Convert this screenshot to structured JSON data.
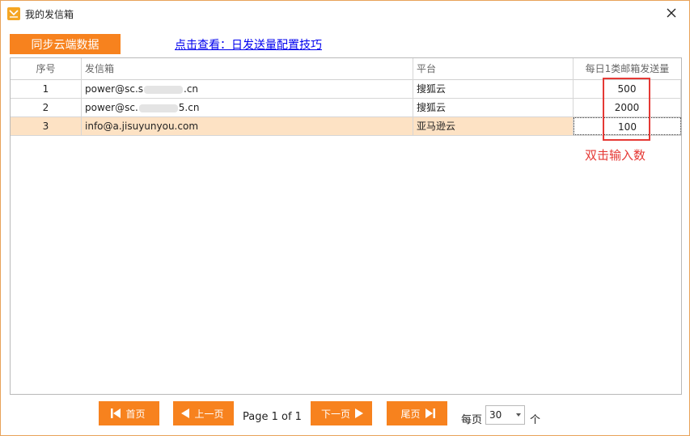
{
  "window": {
    "title": "我的发信箱",
    "close_label": "×"
  },
  "toolbar": {
    "sync_label": "同步云端数据",
    "help_link": "点击查看：日发送量配置技巧"
  },
  "grid": {
    "columns": [
      "序号",
      "发信箱",
      "平台",
      "每日1类邮箱发送量"
    ],
    "rows": [
      {
        "index": "1",
        "mailbox_prefix": "power@sc.s",
        "mailbox_suffix": ".cn",
        "platform": "搜狐云",
        "quantity": "500"
      },
      {
        "index": "2",
        "mailbox_prefix": "power@sc.",
        "mailbox_suffix": "5.cn",
        "platform": "搜狐云",
        "quantity": "2000"
      },
      {
        "index": "3",
        "mailbox_prefix": "info@a.jisuyunyou.com",
        "mailbox_suffix": "",
        "platform": "亚马逊云",
        "quantity": "100"
      }
    ],
    "selected_row": 3
  },
  "annotation": {
    "hint": "双击输入数",
    "color": "#e53935"
  },
  "pager": {
    "first_label": "首页",
    "prev_label": "上一页",
    "next_label": "下一页",
    "last_label": "尾页",
    "page_info": "Page 1 of 1",
    "per_page_label": "每页",
    "per_page_value": "30",
    "per_page_unit": "个"
  },
  "colors": {
    "accent": "#f7821e",
    "selected_row": "#fde2c4",
    "link": "#0000ee"
  }
}
